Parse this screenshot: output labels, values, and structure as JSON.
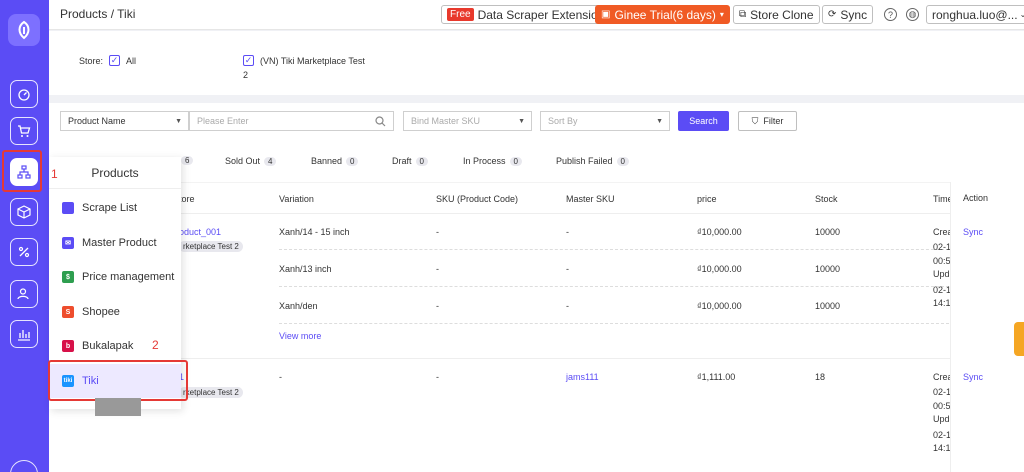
{
  "topbar": {
    "breadcrumb": "Products / Tiki",
    "free_badge": "Free",
    "scraper_label": "Data Scraper Extension",
    "trial_label": "Ginee Trial(6 days)",
    "store_clone_label": "Store Clone",
    "sync_label": "Sync",
    "user_label": "ronghua.luo@..."
  },
  "store_filter": {
    "label": "Store:",
    "all_label": "All",
    "store_name": "(VN) Tiki Marketplace Test",
    "store_suffix": "2"
  },
  "filters": {
    "product_name_select": "Product Name",
    "search_placeholder": "Please Enter",
    "master_sku_placeholder": "Bind Master SKU",
    "sort_placeholder": "Sort By",
    "search_button": "Search",
    "filter_button": "Filter"
  },
  "status_tabs": [
    {
      "label": "",
      "count": "6"
    },
    {
      "label": "Sold Out",
      "count": "4"
    },
    {
      "label": "Banned",
      "count": "0"
    },
    {
      "label": "Draft",
      "count": "0"
    },
    {
      "label": "In Process",
      "count": "0"
    },
    {
      "label": "Publish Failed",
      "count": "0"
    }
  ],
  "table": {
    "headers": {
      "store": "tore",
      "variation": "Variation",
      "sku": "SKU (Product Code)",
      "master_sku": "Master SKU",
      "price": "price",
      "stock": "Stock",
      "time": "Time",
      "action": "Action"
    },
    "rows": [
      {
        "product": "oduct_001",
        "store_tag": "rketplace Test 2",
        "variants": [
          {
            "variation": "Xanh/14 - 15 inch",
            "sku": "-",
            "master_sku": "-",
            "price": "₫10,000.00",
            "stock": "10000"
          },
          {
            "variation": "Xanh/13 inch",
            "sku": "-",
            "master_sku": "-",
            "price": "₫10,000.00",
            "stock": "10000"
          },
          {
            "variation": "Xanh/den",
            "sku": "-",
            "master_sku": "-",
            "price": "₫10,000.00",
            "stock": "10000"
          }
        ],
        "view_more": "View more",
        "time_lines": [
          "Crea",
          "02-1",
          "00:5",
          "Upd",
          "02-1",
          "14:1"
        ],
        "action": "Sync"
      },
      {
        "product": "1",
        "store_tag": "rketplace Test 2",
        "variants": [
          {
            "variation": "-",
            "sku": "-",
            "master_sku": "jams111",
            "price": "₫1,111.00",
            "stock": "18"
          }
        ],
        "time_lines": [
          "Crea",
          "02-1",
          "00:5",
          "Upd",
          "02-1",
          "14:1"
        ],
        "action": "Sync"
      }
    ]
  },
  "products_menu": {
    "title": "Products",
    "items": [
      {
        "label": "Scrape List",
        "color": "#5b4cf5"
      },
      {
        "label": "Master Product",
        "color": "#5b4cf5"
      },
      {
        "label": "Price management",
        "color": "#2e9e4f"
      },
      {
        "label": "Shopee",
        "color": "#ee4d2d"
      },
      {
        "label": "Bukalapak",
        "color": "#d71149"
      },
      {
        "label": "Tiki",
        "color": "#1a94ff"
      }
    ]
  },
  "annotations": {
    "step1": "1",
    "step2": "2"
  }
}
